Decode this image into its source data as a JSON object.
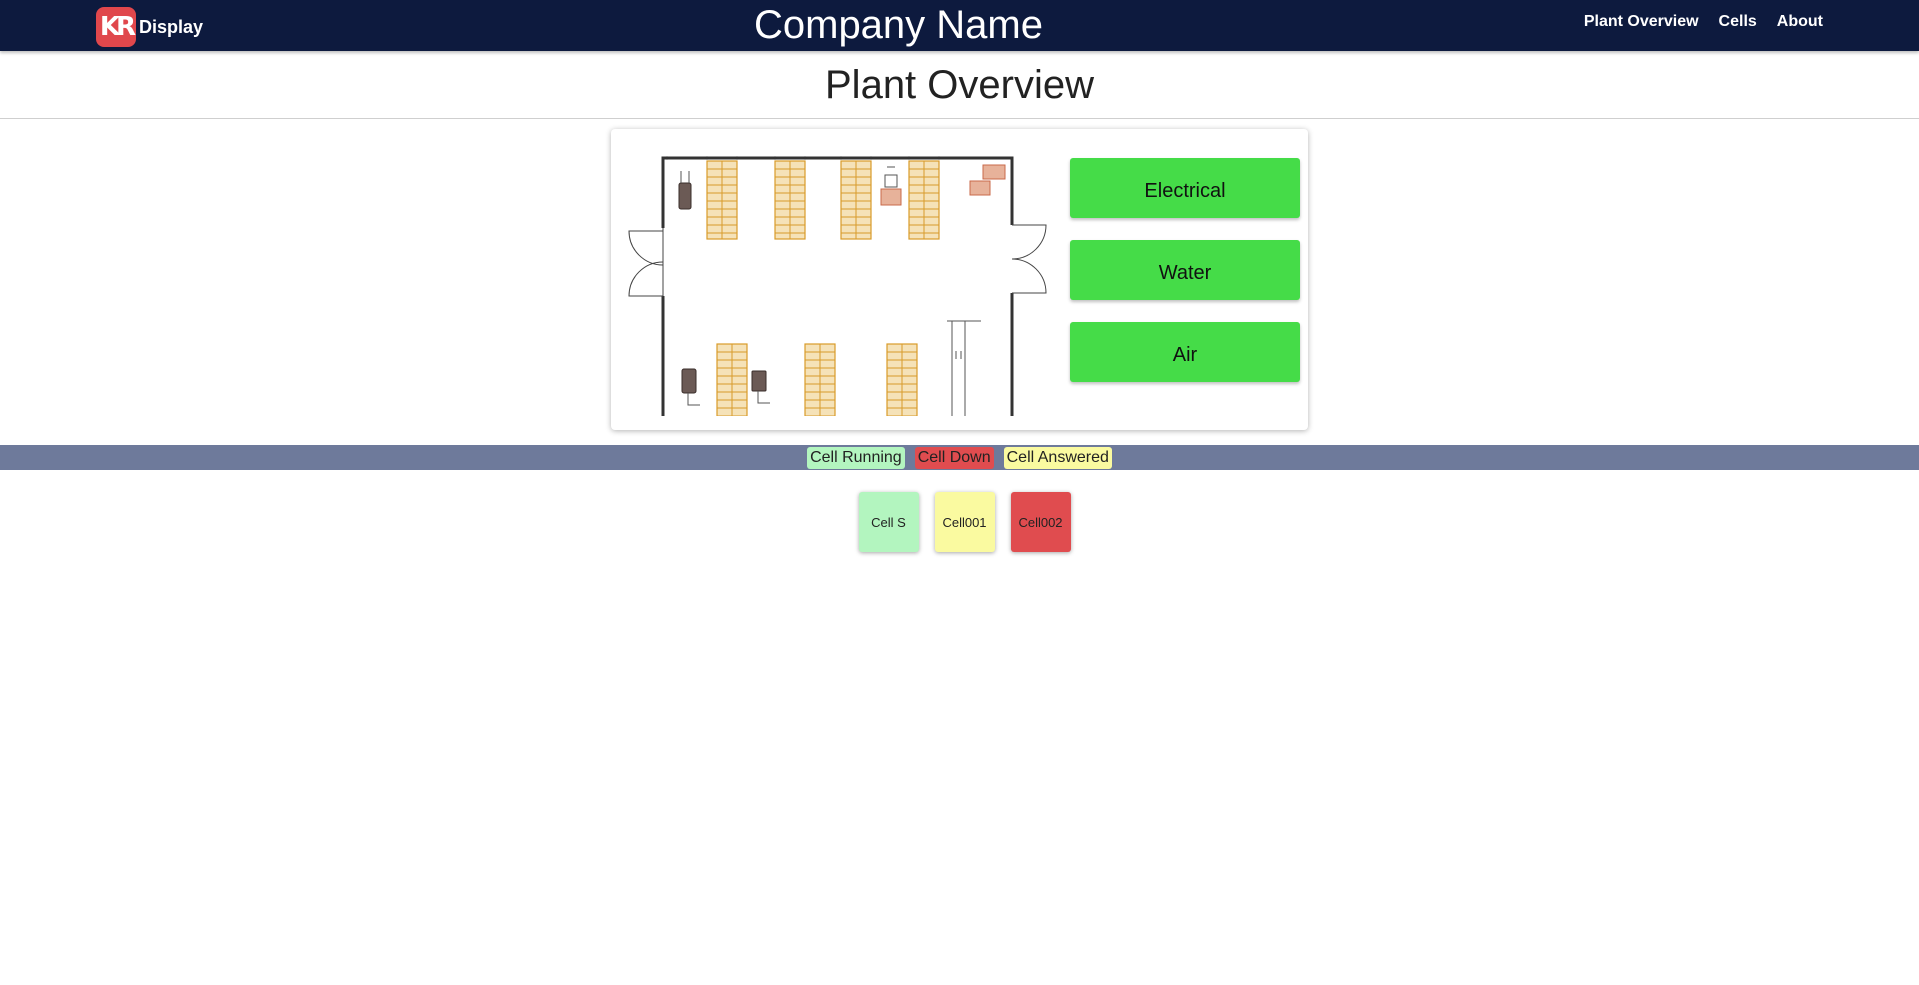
{
  "navbar": {
    "logo_text": "KR",
    "brand": "Display",
    "company": "Company Name",
    "links": [
      "Plant Overview",
      "Cells",
      "About"
    ]
  },
  "page": {
    "title": "Plant Overview"
  },
  "utilities": [
    {
      "label": "Electrical",
      "color": "#45dc48"
    },
    {
      "label": "Water",
      "color": "#45dc48"
    },
    {
      "label": "Air",
      "color": "#45dc48"
    }
  ],
  "legend": {
    "running": "Cell Running",
    "down": "Cell Down",
    "answered": "Cell Answered"
  },
  "cells": [
    {
      "label": "Cell S",
      "status": "running"
    },
    {
      "label": "Cell001",
      "status": "answered"
    },
    {
      "label": "Cell002",
      "status": "down"
    }
  ],
  "colors": {
    "navbar": "#0d1a3e",
    "legend_bar": "#6e7a9b",
    "running": "#b3f5bf",
    "down": "#e04c4f",
    "answered": "#fafaa0",
    "utility_ok": "#45dc48"
  }
}
